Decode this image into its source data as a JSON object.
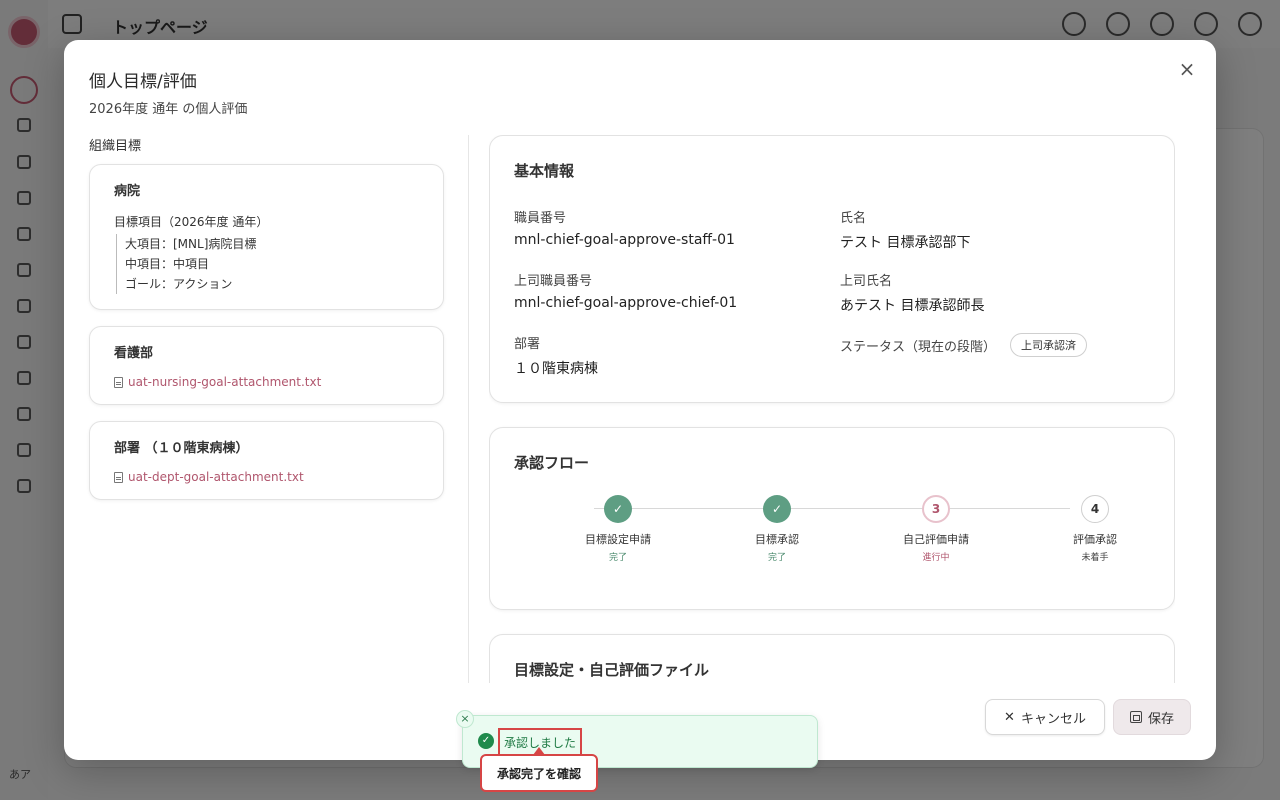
{
  "app": {
    "header_title": "トップページ",
    "user_initials": "あア"
  },
  "modal": {
    "title": "個人目標/評価",
    "subtitle": "2026年度 通年 の個人評価",
    "close_symbol": "×",
    "org_goals": {
      "label": "組織目標",
      "hospital": {
        "title": "病院",
        "goal_heading": "目標項目（2026年度 通年）",
        "items": [
          "大項目：[MNL]病院目標",
          "中項目：中項目",
          "ゴール：アクション"
        ]
      },
      "nursing": {
        "title": "看護部",
        "attachment": "uat-nursing-goal-attachment.txt"
      },
      "department": {
        "title": "部署 （１０階東病棟）",
        "attachment": "uat-dept-goal-attachment.txt"
      }
    },
    "basic_info": {
      "title": "基本情報",
      "staff_id_label": "職員番号",
      "staff_id": "mnl-chief-goal-approve-staff-01",
      "name_label": "氏名",
      "name": "テスト 目標承認部下",
      "boss_id_label": "上司職員番号",
      "boss_id": "mnl-chief-goal-approve-chief-01",
      "boss_name_label": "上司氏名",
      "boss_name": "あテスト 目標承認師長",
      "dept_label": "部署",
      "dept": "１０階東病棟",
      "status_label": "ステータス（現在の段階）",
      "status_badge": "上司承認済"
    },
    "approval_flow": {
      "title": "承認フロー",
      "steps": [
        {
          "marker": "✓",
          "name": "目標設定申請",
          "status": "完了"
        },
        {
          "marker": "✓",
          "name": "目標承認",
          "status": "完了"
        },
        {
          "marker": "3",
          "name": "自己評価申請",
          "status": "進行中"
        },
        {
          "marker": "4",
          "name": "評価承認",
          "status": "未着手"
        }
      ]
    },
    "files": {
      "title": "目標設定・自己評価ファイル"
    },
    "buttons": {
      "cancel": "キャンセル",
      "cancel_icon": "✕",
      "save": "保存"
    }
  },
  "toast": {
    "message": "承認しました",
    "close_symbol": "×",
    "icon": "✓",
    "tooltip": "承認完了を確認"
  },
  "colors": {
    "accent": "#b0566d",
    "success": "#5e9e83",
    "toast_bg": "#eafbf1",
    "highlight": "#d64545"
  }
}
